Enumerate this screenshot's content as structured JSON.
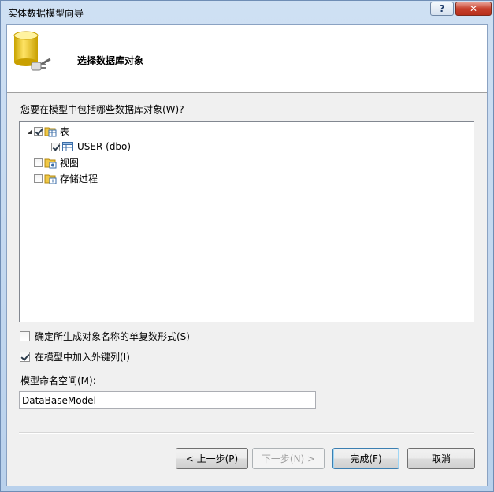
{
  "window": {
    "title": "实体数据模型向导"
  },
  "header": {
    "title": "选择数据库对象"
  },
  "prompt": {
    "text": "您要在模型中包括哪些数据库对象(W)?"
  },
  "tree": {
    "nodes": [
      {
        "label": "表",
        "checked": true,
        "expanded": true,
        "icon": "table-folder-icon"
      },
      {
        "label": "USER (dbo)",
        "checked": true,
        "icon": "table-icon"
      },
      {
        "label": "视图",
        "checked": false,
        "icon": "view-folder-icon"
      },
      {
        "label": "存储过程",
        "checked": false,
        "icon": "sproc-folder-icon"
      }
    ]
  },
  "options": {
    "pluralize": {
      "label": "确定所生成对象名称的单复数形式(S)",
      "checked": false
    },
    "foreign_keys": {
      "label": "在模型中加入外键列(I)",
      "checked": true
    }
  },
  "namespace": {
    "label": "模型命名空间(M):",
    "value": "DataBaseModel"
  },
  "buttons": {
    "prev": "< 上一步(P)",
    "next": "下一步(N) >",
    "finish": "完成(F)",
    "cancel": "取消"
  },
  "titlebar_buttons": {
    "help": "?",
    "close": "✕"
  }
}
